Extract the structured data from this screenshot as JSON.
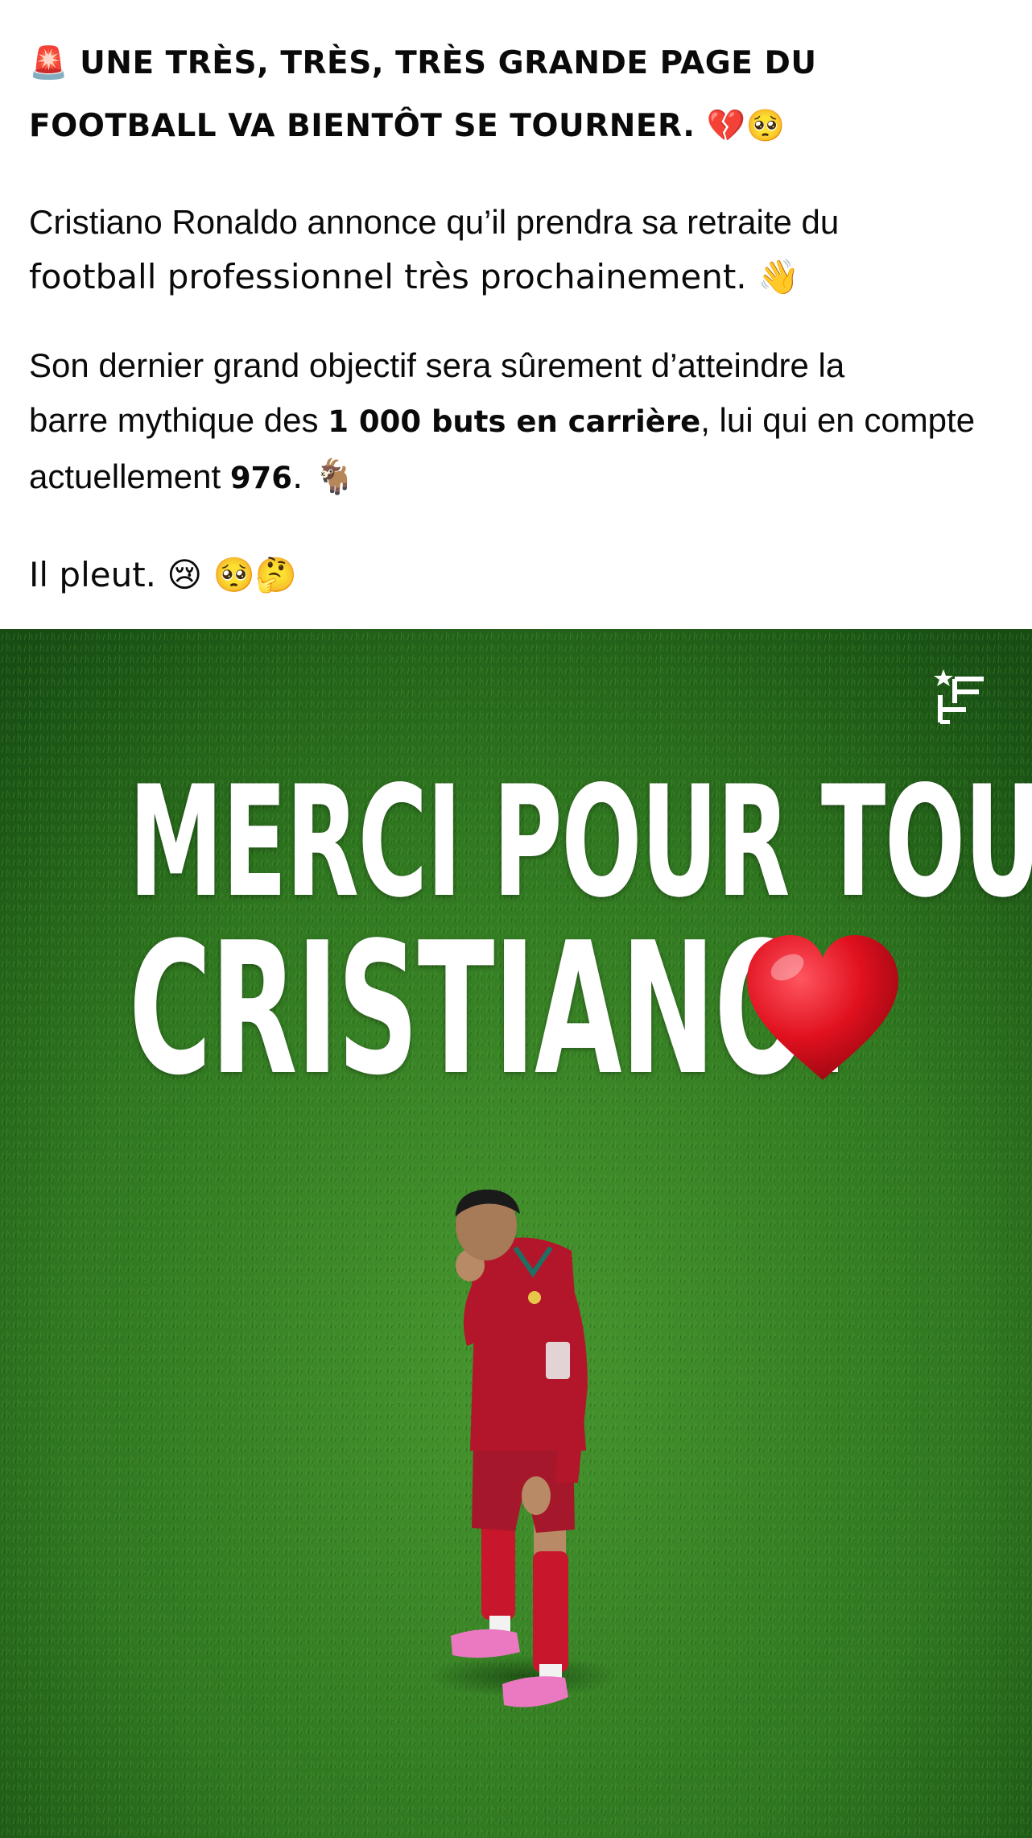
{
  "post": {
    "headline_line1": "🚨 UNE TRÈS, TRÈS, TRÈS GRANDE PAGE DU",
    "headline_line2": "FOOTBALL VA BIENTÔT SE TOURNER. 💔🥺",
    "p1_line1": "Cristiano Ronaldo annonce qu’il prendra sa retraite du",
    "p1_line2": "football professionnel très prochainement. 👋",
    "p2_line1": "Son dernier grand objectif sera sûrement d’atteindre la",
    "p2_line2_pre": "barre mythique des ",
    "p2_line2_bold": "1 000 buts en carrière",
    "p2_line2_post": ", lui qui en compte",
    "p2_line3_pre": "actuellement ",
    "p2_line3_bold": "976",
    "p2_line3_post": ". 🐐",
    "p3": "Il pleut. 😢  🥺🤔"
  },
  "image": {
    "overlay_line1": "MERCI POUR TOUT,",
    "overlay_line2": "CRISTIANO.",
    "heart_icon": "red-heart-icon",
    "brand_icon": "star-f-logo-icon"
  },
  "colors": {
    "grass_dark": "#1d5a17",
    "grass_light": "#3f8d2c",
    "jersey_red": "#b3162a",
    "heart_red": "#e0101e",
    "avatar_ring": "#1877f2"
  }
}
